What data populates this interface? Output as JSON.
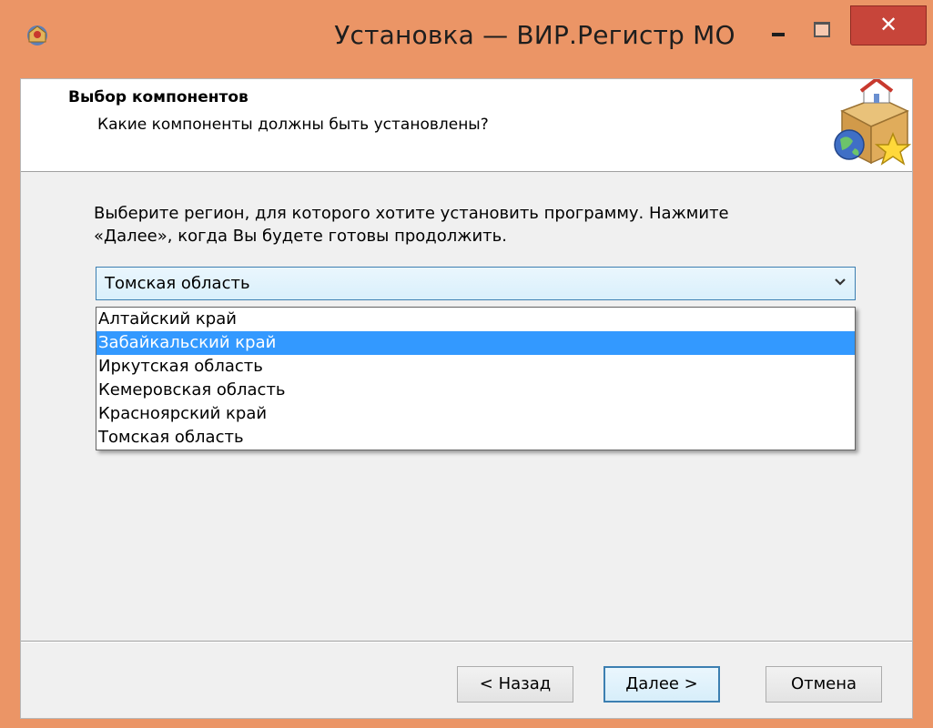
{
  "window": {
    "title": "Установка — ВИР.Регистр МО",
    "close_glyph": "✕"
  },
  "header": {
    "title": "Выбор компонентов",
    "subtitle": "Какие компоненты должны быть установлены?"
  },
  "main": {
    "instructions": "Выберите регион, для которого хотите установить программу. Нажмите «Далее», когда Вы будете готовы продолжить.",
    "region_select": {
      "value": "Томская область",
      "options": [
        "Алтайский край",
        "Забайкальский край",
        "Иркутская область",
        "Кемеровская область",
        "Красноярский край",
        "Томская область"
      ],
      "highlighted_index": 1
    }
  },
  "footer": {
    "back_label": "< Назад",
    "next_label": "Далее >",
    "cancel_label": "Отмена"
  },
  "colors": {
    "title_bar": "#eb9566",
    "close_button": "#c7453a",
    "selection": "#3399ff",
    "focus_border": "#3c7fb1"
  }
}
